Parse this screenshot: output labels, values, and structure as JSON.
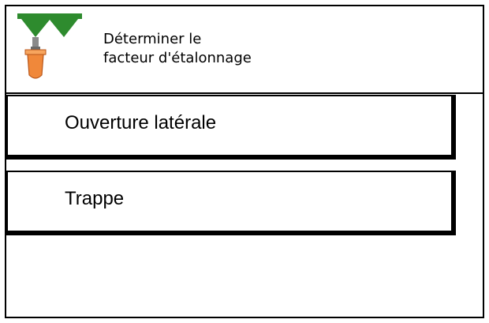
{
  "header": {
    "icon": "spreader-bucket-icon",
    "title_line1": "Déterminer le",
    "title_line2": "facteur d'étalonnage"
  },
  "menu": {
    "items": [
      {
        "label": "Ouverture latérale"
      },
      {
        "label": "Trappe"
      }
    ]
  },
  "colors": {
    "spreader_green": "#2e8b2e",
    "bucket_orange": "#f0883a",
    "border": "#000000",
    "background": "#ffffff"
  }
}
